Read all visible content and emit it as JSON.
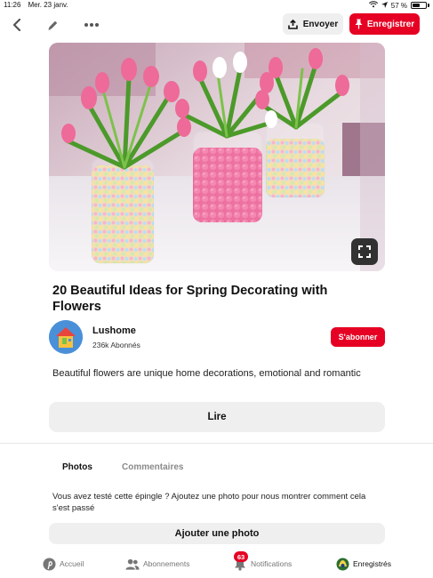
{
  "status_bar": {
    "time": "11:26",
    "date": "Mer. 23 janv.",
    "battery_text": "57 %",
    "battery_level": 0.57
  },
  "toolbar": {
    "back_icon": "chevron-left-icon",
    "edit_icon": "pencil-icon",
    "more_icon": "more-horizontal-icon",
    "send_label": "Envoyer",
    "save_label": "Enregistrer"
  },
  "pin": {
    "title": "20 Beautiful Ideas for Spring Decorating with Flowers",
    "author_name": "Lushome",
    "author_followers": "236k Abonnés",
    "follow_label": "S'abonner",
    "description": "Beautiful flowers are unique home decorations, emotional and romantic",
    "read_label": "Lire"
  },
  "tabs": {
    "photos": "Photos",
    "comments": "Commentaires"
  },
  "photos_section": {
    "prompt": "Vous avez testé cette épingle ? Ajoutez une photo pour nous montrer comment cela s'est passé",
    "add_photo_label": "Ajouter une photo"
  },
  "bottom_nav": {
    "home": "Accueil",
    "following": "Abonnements",
    "notifications": "Notifications",
    "notifications_count": "63",
    "saved": "Enregistrés"
  },
  "colors": {
    "accent": "#e60023",
    "button_bg": "#efefef"
  }
}
